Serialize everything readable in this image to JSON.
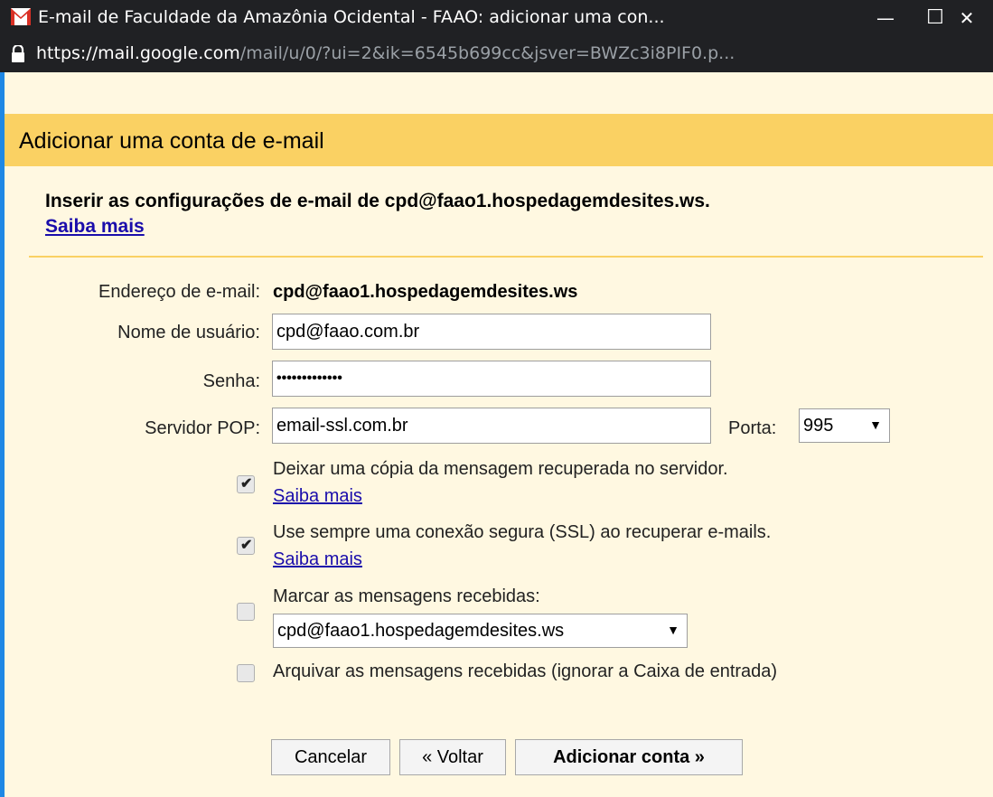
{
  "window": {
    "title": "E-mail de Faculdade da Amazônia Ocidental - FAAO: adicionar uma con...",
    "minimize": "—",
    "maximize": "☐",
    "close": "✕",
    "url_host": "https://mail.google.com",
    "url_path": "/mail/u/0/?ui=2&ik=6545b699cc&jsver=BWZc3i8PIF0.p..."
  },
  "dialog": {
    "heading": "Adicionar uma conta de e-mail",
    "intro": "Inserir as configurações de e-mail de cpd@faao1.hospedagemdesites.ws.",
    "learn_more": "Saiba mais"
  },
  "form": {
    "email_label": "Endereço de e-mail:",
    "email_value": "cpd@faao1.hospedagemdesites.ws",
    "username_label": "Nome de usuário:",
    "username_value": "cpd@faao.com.br",
    "password_label": "Senha:",
    "password_value": "•••••••••••••",
    "pop_label": "Servidor POP:",
    "pop_value": "email-ssl.com.br",
    "port_label": "Porta:",
    "port_value": "995"
  },
  "options": {
    "leave_copy": {
      "label": "Deixar uma cópia da mensagem recuperada no servidor.",
      "link": "Saiba mais",
      "checked": true
    },
    "use_ssl": {
      "label": "Use sempre uma conexão segura (SSL) ao recuperar e-mails.",
      "link": "Saiba mais",
      "checked": true
    },
    "label_incoming": {
      "label": "Marcar as mensagens recebidas:",
      "select_value": "cpd@faao1.hospedagemdesites.ws",
      "checked": false
    },
    "archive": {
      "label": "Arquivar as mensagens recebidas (ignorar a Caixa de entrada)",
      "checked": false
    }
  },
  "buttons": {
    "cancel": "Cancelar",
    "back": "« Voltar",
    "add": "Adicionar conta »"
  },
  "colors": {
    "header": "#fad163",
    "background": "#fff8e1",
    "titlebar": "#202124",
    "link": "#1a0dab"
  }
}
